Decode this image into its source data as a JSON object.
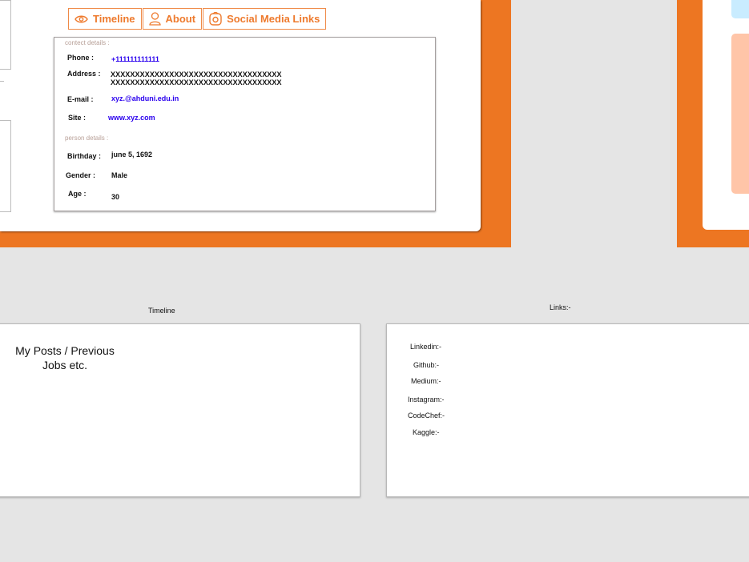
{
  "tabs": [
    {
      "label": "Timeline",
      "icon": "eye-icon"
    },
    {
      "label": "About",
      "icon": "user-icon"
    },
    {
      "label": "Social Media Links",
      "icon": "instagram-icon"
    }
  ],
  "contact": {
    "section_label": "contect details :",
    "phone_label": "Phone :",
    "phone_value": "+111111111111",
    "address_label": "Address :",
    "address_line1": "XXXXXXXXXXXXXXXXXXXXXXXXXXXXXXXXXXX",
    "address_line2": "XXXXXXXXXXXXXXXXXXXXXXXXXXXXXXXXXXX",
    "email_label": "E-mail :",
    "email_value": "xyz.@ahduni.edu.in",
    "site_label": "Site :",
    "site_value": "www.xyz.com"
  },
  "person": {
    "section_label": "person details :",
    "birthday_label": "Birthday :",
    "birthday_value": "june 5, 1692",
    "gender_label": "Gender :",
    "gender_value": "Male",
    "age_label": "Age :",
    "age_value": "30"
  },
  "timeline": {
    "caption": "Timeline",
    "title": "My Posts / Previous Jobs etc."
  },
  "links": {
    "caption": "Links:-",
    "items": [
      "Linkedin:-",
      "Github:-",
      "Medium:-",
      "Instagram:-",
      "CodeChef:-",
      "Kaggle:-"
    ]
  },
  "colors": {
    "accent": "#ed7622",
    "link_blue": "#2a00ee",
    "light_blue": "#c9ecff",
    "peach": "#ffc5a8"
  }
}
